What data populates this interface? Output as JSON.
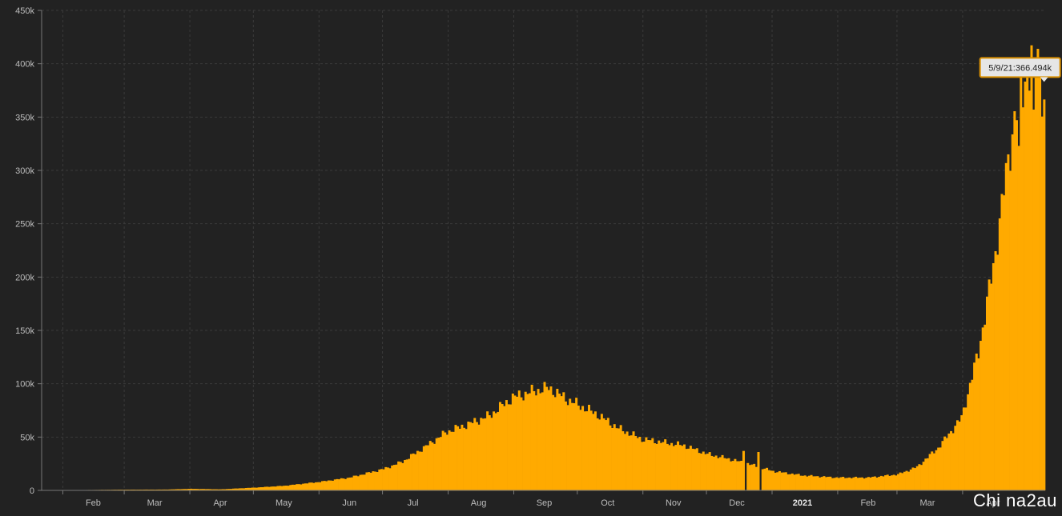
{
  "watermark": "Chi na2au",
  "chart_data": {
    "type": "bar",
    "title": "",
    "xlabel": "",
    "ylabel": "",
    "ylim": [
      0,
      450000
    ],
    "y_ticks": [
      0,
      50000,
      100000,
      150000,
      200000,
      250000,
      300000,
      350000,
      400000,
      450000
    ],
    "y_tick_labels": [
      "0",
      "50k",
      "100k",
      "150k",
      "200k",
      "250k",
      "300k",
      "350k",
      "400k",
      "450k"
    ],
    "x_ticks": [
      {
        "date": "2020-02-01",
        "label": "Feb",
        "bold": false
      },
      {
        "date": "2020-03-01",
        "label": "Mar",
        "bold": false
      },
      {
        "date": "2020-04-01",
        "label": "Apr",
        "bold": false
      },
      {
        "date": "2020-05-01",
        "label": "May",
        "bold": false
      },
      {
        "date": "2020-06-01",
        "label": "Jun",
        "bold": false
      },
      {
        "date": "2020-07-01",
        "label": "Jul",
        "bold": false
      },
      {
        "date": "2020-08-01",
        "label": "Aug",
        "bold": false
      },
      {
        "date": "2020-09-01",
        "label": "Sep",
        "bold": false
      },
      {
        "date": "2020-10-01",
        "label": "Oct",
        "bold": false
      },
      {
        "date": "2020-11-01",
        "label": "Nov",
        "bold": false
      },
      {
        "date": "2020-12-01",
        "label": "Dec",
        "bold": false
      },
      {
        "date": "2021-01-01",
        "label": "2021",
        "bold": true
      },
      {
        "date": "2021-02-01",
        "label": "Feb",
        "bold": false
      },
      {
        "date": "2021-03-01",
        "label": "Mar",
        "bold": false
      },
      {
        "date": "2021-04-01",
        "label": "Apr",
        "bold": false
      }
    ],
    "x_range": [
      "2020-01-22",
      "2021-05-09"
    ],
    "grid": true,
    "bar_color": "#FFAA00",
    "background": "#222222",
    "tooltip": {
      "text": "5/9/21:366.494k",
      "date": "2021-05-09",
      "value": 366494
    },
    "daily_values_anchors": [
      [
        "2020-01-22",
        0
      ],
      [
        "2020-03-01",
        700
      ],
      [
        "2020-03-20",
        800
      ],
      [
        "2020-04-01",
        1500
      ],
      [
        "2020-04-15",
        1000
      ],
      [
        "2020-05-01",
        2600
      ],
      [
        "2020-05-15",
        4300
      ],
      [
        "2020-06-01",
        8000
      ],
      [
        "2020-06-15",
        12000
      ],
      [
        "2020-07-01",
        20000
      ],
      [
        "2020-07-10",
        27000
      ],
      [
        "2020-07-20",
        40000
      ],
      [
        "2020-07-31",
        55000
      ],
      [
        "2020-08-10",
        62000
      ],
      [
        "2020-08-20",
        70000
      ],
      [
        "2020-08-31",
        87000
      ],
      [
        "2020-09-10",
        93000
      ],
      [
        "2020-09-17",
        96000
      ],
      [
        "2020-09-25",
        86000
      ],
      [
        "2020-10-01",
        80000
      ],
      [
        "2020-10-10",
        71000
      ],
      [
        "2020-10-20",
        58000
      ],
      [
        "2020-10-31",
        48000
      ],
      [
        "2020-11-10",
        45000
      ],
      [
        "2020-11-20",
        42000
      ],
      [
        "2020-12-01",
        34000
      ],
      [
        "2020-12-10",
        30000
      ],
      [
        "2020-12-20",
        25000
      ],
      [
        "2021-01-01",
        18000
      ],
      [
        "2021-01-15",
        14000
      ],
      [
        "2021-01-31",
        12000
      ],
      [
        "2021-02-15",
        12000
      ],
      [
        "2021-03-01",
        15000
      ],
      [
        "2021-03-10",
        22000
      ],
      [
        "2021-03-20",
        40000
      ],
      [
        "2021-03-31",
        68000
      ],
      [
        "2021-04-08",
        130000
      ],
      [
        "2021-04-15",
        210000
      ],
      [
        "2021-04-21",
        295000
      ],
      [
        "2021-04-25",
        350000
      ],
      [
        "2021-04-30",
        385000
      ],
      [
        "2021-05-05",
        412000
      ],
      [
        "2021-05-09",
        366494
      ]
    ],
    "daily_values_spikes": [
      [
        "2020-12-18",
        37000
      ],
      [
        "2020-12-19",
        0
      ],
      [
        "2020-12-25",
        36000
      ],
      [
        "2020-12-26",
        0
      ],
      [
        "2021-04-27",
        323000
      ],
      [
        "2021-05-04",
        357000
      ],
      [
        "2021-05-06",
        414000
      ],
      [
        "2021-05-07",
        401000
      ]
    ]
  }
}
